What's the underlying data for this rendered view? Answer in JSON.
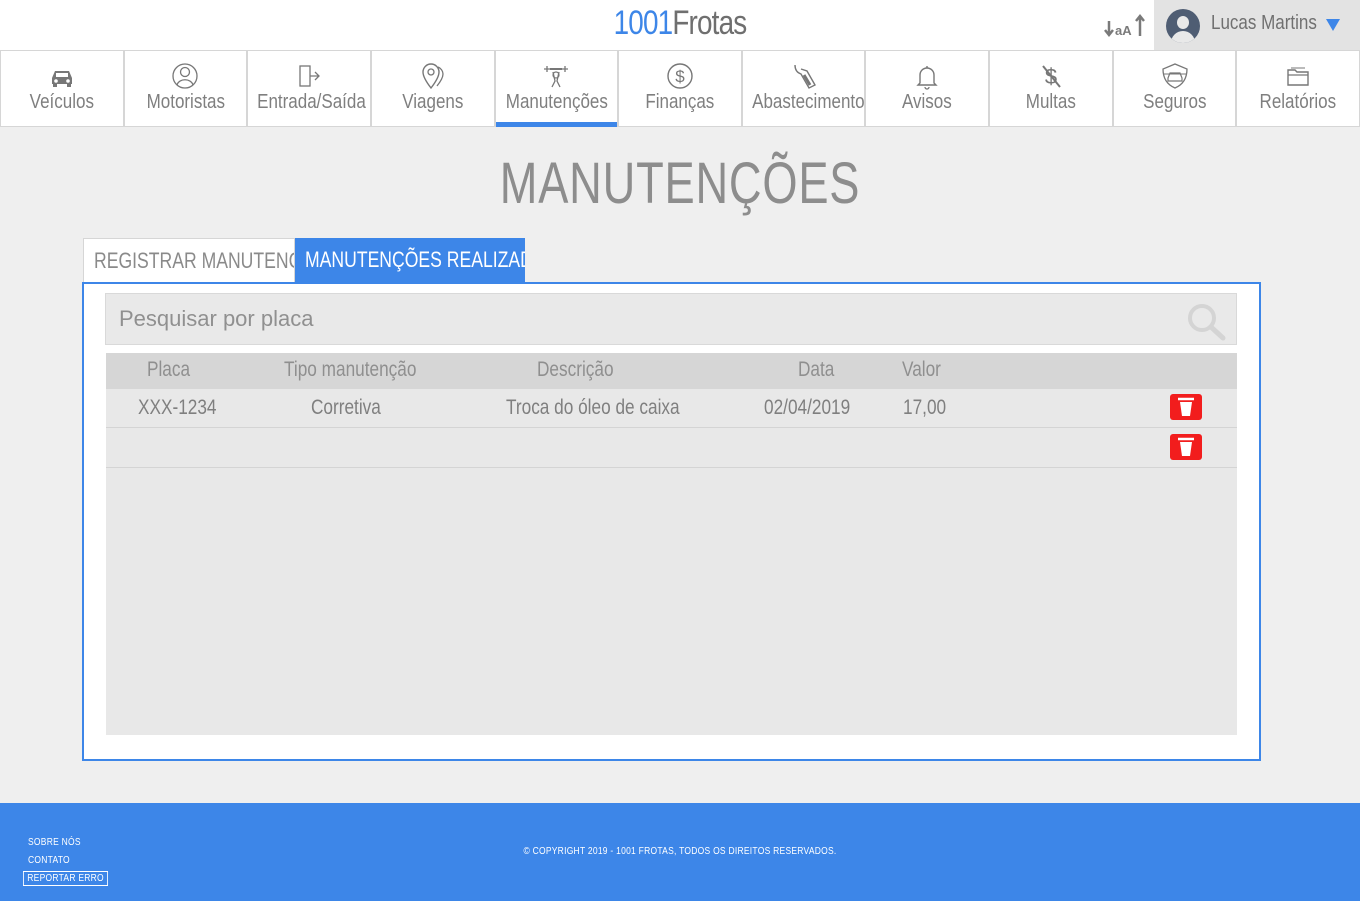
{
  "header": {
    "brand_number": "1001",
    "brand_name": "Frotas",
    "font_size_toggle": "aA",
    "user_name": "Lucas Martins"
  },
  "nav": {
    "items": [
      {
        "label": "Veículos",
        "icon": "car-icon"
      },
      {
        "label": "Motoristas",
        "icon": "driver-icon"
      },
      {
        "label": "Entrada/Saída",
        "icon": "door-exit-icon"
      },
      {
        "label": "Viagens",
        "icon": "map-pin-icon"
      },
      {
        "label": "Manutenções",
        "icon": "wrench-icon",
        "active": true
      },
      {
        "label": "Finanças",
        "icon": "dollar-icon"
      },
      {
        "label": "Abastecimento",
        "icon": "fuel-nozzle-icon"
      },
      {
        "label": "Avisos",
        "icon": "bell-icon"
      },
      {
        "label": "Multas",
        "icon": "no-dollar-icon"
      },
      {
        "label": "Seguros",
        "icon": "car-shield-icon"
      },
      {
        "label": "Relatórios",
        "icon": "folder-icon"
      }
    ]
  },
  "page": {
    "title": "MANUTENÇÕES",
    "tabs": [
      "REGISTRAR MANUTENÇÃO",
      "MANUTENÇÕES REALIZADAS"
    ],
    "active_tab": 1
  },
  "search": {
    "placeholder": "Pesquisar por placa",
    "value": ""
  },
  "table": {
    "headers": [
      "Placa",
      "Tipo manutenção",
      "Descrição",
      "Data",
      "Valor"
    ],
    "rows": [
      [
        "XXX-1234",
        "Corretiva",
        "Troca do óleo de caixa",
        "02/04/2019",
        "17,00"
      ],
      [
        "",
        "",
        "",
        "",
        ""
      ]
    ]
  },
  "footer": {
    "links": [
      "SOBRE NÓS",
      "CONTATO",
      "REPORTAR ERRO"
    ],
    "copyright": "© COPYRIGHT 2019 - 1001 FROTAS, TODOS OS DIREITOS RESERVADOS."
  },
  "colors": {
    "accent": "#3d86e8",
    "delete": "#f21d1d",
    "background": "#efefef"
  }
}
